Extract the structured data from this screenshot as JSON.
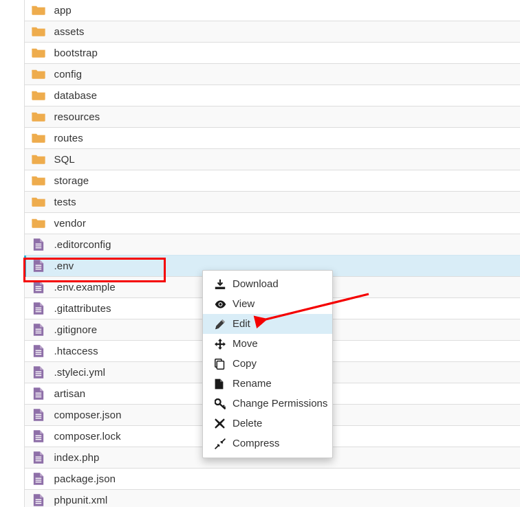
{
  "file_manager": {
    "columns": [
      "icon",
      "name"
    ],
    "rows": [
      {
        "name": "app",
        "type": "folder",
        "icon": "folder-icon",
        "selected": false
      },
      {
        "name": "assets",
        "type": "folder",
        "icon": "folder-icon",
        "selected": false
      },
      {
        "name": "bootstrap",
        "type": "folder",
        "icon": "folder-icon",
        "selected": false
      },
      {
        "name": "config",
        "type": "folder",
        "icon": "folder-icon",
        "selected": false
      },
      {
        "name": "database",
        "type": "folder",
        "icon": "folder-icon",
        "selected": false
      },
      {
        "name": "resources",
        "type": "folder",
        "icon": "folder-icon",
        "selected": false
      },
      {
        "name": "routes",
        "type": "folder",
        "icon": "folder-icon",
        "selected": false
      },
      {
        "name": "SQL",
        "type": "folder",
        "icon": "folder-icon",
        "selected": false
      },
      {
        "name": "storage",
        "type": "folder",
        "icon": "folder-icon",
        "selected": false
      },
      {
        "name": "tests",
        "type": "folder",
        "icon": "folder-icon",
        "selected": false
      },
      {
        "name": "vendor",
        "type": "folder",
        "icon": "folder-icon",
        "selected": false
      },
      {
        "name": ".editorconfig",
        "type": "file",
        "icon": "file-icon",
        "selected": false
      },
      {
        "name": ".env",
        "type": "file",
        "icon": "file-icon",
        "selected": true
      },
      {
        "name": ".env.example",
        "type": "file",
        "icon": "file-icon",
        "selected": false
      },
      {
        "name": ".gitattributes",
        "type": "file",
        "icon": "file-icon",
        "selected": false
      },
      {
        "name": ".gitignore",
        "type": "file",
        "icon": "file-icon",
        "selected": false
      },
      {
        "name": ".htaccess",
        "type": "file",
        "icon": "file-icon",
        "selected": false
      },
      {
        "name": ".styleci.yml",
        "type": "file",
        "icon": "file-icon",
        "selected": false
      },
      {
        "name": "artisan",
        "type": "file",
        "icon": "file-icon",
        "selected": false
      },
      {
        "name": "composer.json",
        "type": "file",
        "icon": "file-icon",
        "selected": false
      },
      {
        "name": "composer.lock",
        "type": "file",
        "icon": "file-icon",
        "selected": false
      },
      {
        "name": "index.php",
        "type": "file",
        "icon": "file-icon",
        "selected": false
      },
      {
        "name": "package.json",
        "type": "file",
        "icon": "file-icon",
        "selected": false
      },
      {
        "name": "phpunit.xml",
        "type": "file",
        "icon": "file-icon",
        "selected": false
      }
    ]
  },
  "context_menu": {
    "items": [
      {
        "label": "Download",
        "icon": "download-icon",
        "active": false
      },
      {
        "label": "View",
        "icon": "eye-icon",
        "active": false
      },
      {
        "label": "Edit",
        "icon": "pencil-icon",
        "active": true
      },
      {
        "label": "Move",
        "icon": "move-arrows-icon",
        "active": false
      },
      {
        "label": "Copy",
        "icon": "copy-icon",
        "active": false
      },
      {
        "label": "Rename",
        "icon": "page-icon",
        "active": false
      },
      {
        "label": "Change Permissions",
        "icon": "key-icon",
        "active": false
      },
      {
        "label": "Delete",
        "icon": "x-mark-icon",
        "active": false
      },
      {
        "label": "Compress",
        "icon": "compress-icon",
        "active": false
      }
    ]
  },
  "annotations": {
    "highlight_box": {
      "target": ".env",
      "color": "#f40000"
    },
    "arrow": {
      "target": "Edit",
      "color": "#f40000"
    }
  },
  "colors": {
    "folder": "#eeac4d",
    "file": "#8e6fa8",
    "selection": "#d9edf7",
    "selection_bar": "#29b6d8",
    "row_alt": "#f9f9f9",
    "border": "#dddddd",
    "text": "#333333",
    "annotation": "#f40000"
  }
}
